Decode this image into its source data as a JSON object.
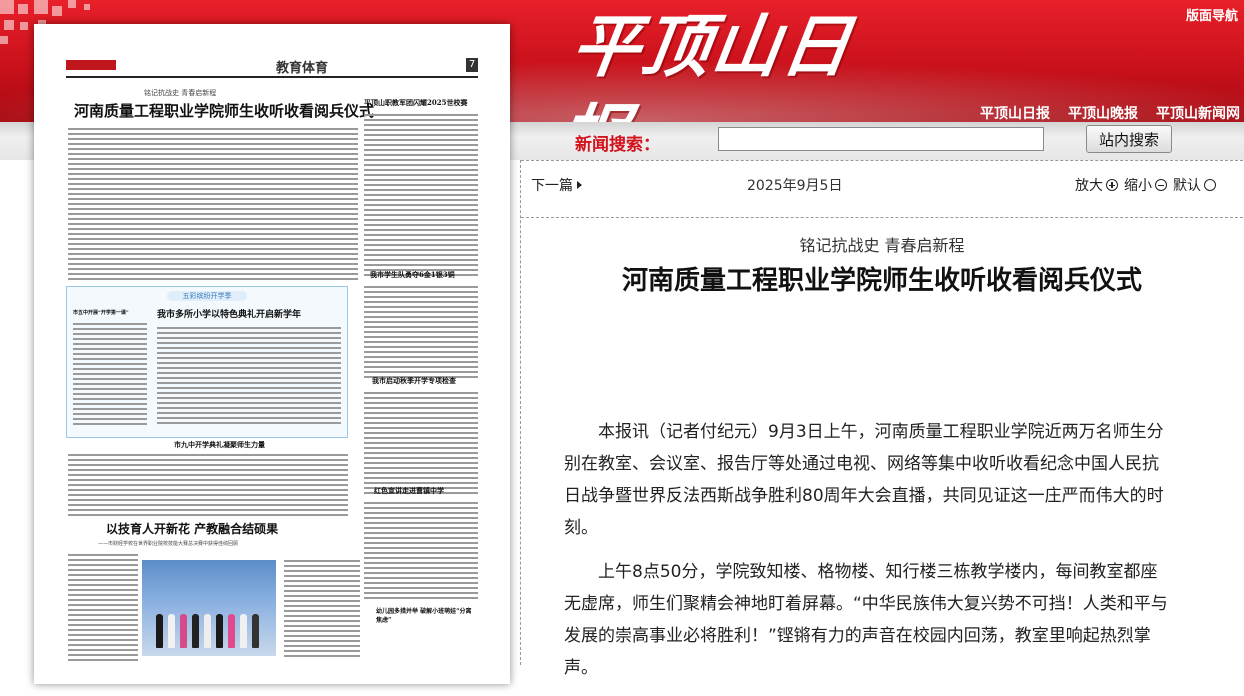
{
  "site": {
    "logo_text": "平顶山日报",
    "nav_link": "版面导航",
    "links": [
      "平顶山日报",
      "平顶山晚报",
      "平顶山新闻网"
    ]
  },
  "search": {
    "label": "新闻搜索：",
    "value": "",
    "button": "站内搜索"
  },
  "paper": {
    "section": "教育体育",
    "page_no": "7",
    "kicker": "铭记抗战史 青春启新程",
    "headline": "河南质量工程职业学院师生收听收看阅兵仪式",
    "side_head_1": "平顶山职教军团闪耀2025世校赛",
    "side_head_2": "我市学生队勇夺6金1银3铜",
    "side_head_3": "我市启动秋季开学专项检查",
    "side_head_4": "红色宣讲走进曹镇中学",
    "side_head_5": "幼儿园多措并举 破解小班萌娃“分离焦虑”",
    "box_banner": "五彩缤纷开学季",
    "box_head": "我市多所小学以特色典礼开启新学年",
    "box_side": "市五中开展“开学第一课”",
    "mid_head": "市九中开学典礼凝聚师生力量",
    "big_head": "以技育人开新花 产教融合结硕果",
    "big_sub": "——市财经学校在世界职业院校技能大赛总决赛中获得佳绩回顾"
  },
  "article": {
    "prev_next": "下一篇",
    "date": "2025年9月5日",
    "zoom_in": "放大",
    "zoom_out": "缩小",
    "zoom_default": "默认",
    "subtitle": "铭记抗战史 青春启新程",
    "title": "河南质量工程职业学院师生收听收看阅兵仪式",
    "paragraphs": [
      "本报讯（记者付纪元）9月3日上午，河南质量工程职业学院近两万名师生分别在教室、会议室、报告厅等处通过电视、网络等集中收听收看纪念中国人民抗日战争暨世界反法西斯战争胜利80周年大会直播，共同见证这一庄严而伟大的时刻。",
      "上午8点50分，学院致知楼、格物楼、知行楼三栋教学楼内，每间教室都座无虚席，师生们聚精会神地盯着屏幕。“中华民族伟大复兴势不可挡！人类和平与发展的崇高事业必将胜利！”铿锵有力的声音在校园内回荡，教室里响起热烈掌声。"
    ]
  },
  "colors": {
    "brand_red": "#d4121c",
    "banner_dark": "#a70a12"
  }
}
